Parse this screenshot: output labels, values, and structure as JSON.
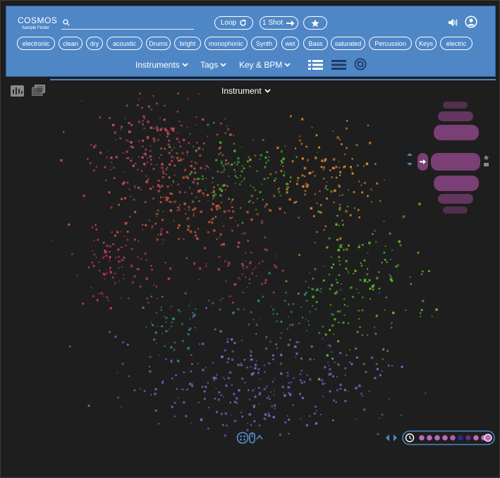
{
  "app": {
    "brand_name": "COSMOS",
    "brand_subtitle": "Sample Finder"
  },
  "search": {
    "value": "",
    "placeholder": ""
  },
  "toolbar": {
    "loop_label": "Loop",
    "oneshot_label": "1 Shot"
  },
  "tags": [
    "electronic",
    "clean",
    "dry",
    "acoustic",
    "Drums",
    "bright",
    "monophonic",
    "Synth",
    "wet",
    "Bass",
    "saturated",
    "Percussion",
    "Keys",
    "electric"
  ],
  "nav": {
    "instruments": "Instruments",
    "tags": "Tags",
    "key_bpm": "Key & BPM"
  },
  "map": {
    "color_by": "Instrument"
  },
  "colors": {
    "header_bg": "#4f86c6",
    "canvas_bg": "#1e1e1e",
    "accent_purple": "#7a3f74",
    "history_dot": "#c06bb8"
  },
  "icons": {
    "search": "search-icon",
    "loop": "loop-icon",
    "oneshot": "arrow-right-icon",
    "favorite": "star-icon",
    "volume": "speaker-icon",
    "account": "account-icon",
    "list_view": "list-view-icon",
    "compact_view": "compact-view-icon",
    "cluster_view": "cluster-view-icon"
  }
}
